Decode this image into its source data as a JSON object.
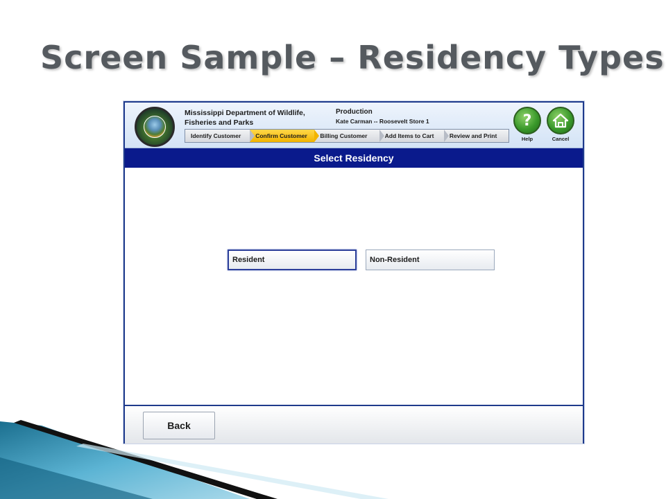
{
  "slide": {
    "title": "Screen Sample – Residency Types"
  },
  "header": {
    "org_name": "Mississippi Department of Wildlife, Fisheries and Parks",
    "environment": "Production",
    "user_store": "Kate Carman -- Roosevelt Store 1"
  },
  "steps": [
    {
      "label": "Identify Customer",
      "active": false
    },
    {
      "label": "Confirm Customer",
      "active": true
    },
    {
      "label": "Billing Customer",
      "active": false
    },
    {
      "label": "Add Items to Cart",
      "active": false
    },
    {
      "label": "Review and Print",
      "active": false
    }
  ],
  "buttons": {
    "help_label": "Help",
    "help_glyph": "?",
    "cancel_label": "Cancel",
    "cancel_icon": "home-icon",
    "back_label": "Back"
  },
  "section": {
    "title": "Select Residency"
  },
  "residency_options": [
    {
      "label": "Resident",
      "selected": true
    },
    {
      "label": "Non-Resident",
      "selected": false
    }
  ],
  "colors": {
    "section_bar": "#0a1a8c",
    "active_step": "#f2b400",
    "header_button": "#3b9a2c"
  }
}
